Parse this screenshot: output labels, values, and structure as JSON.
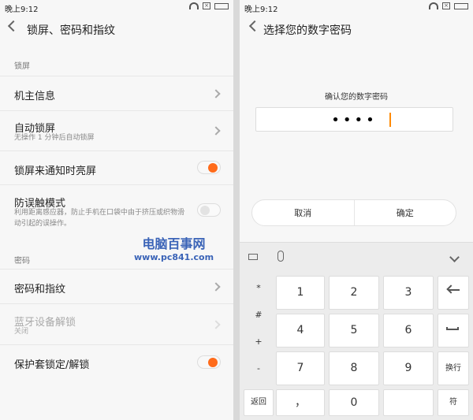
{
  "left": {
    "status": {
      "time": "晚上9:12",
      "close_badge": "×"
    },
    "header": {
      "title": "锁屏、密码和指纹"
    },
    "sections": [
      {
        "label": "锁屏"
      },
      {
        "label": "密码"
      }
    ],
    "items": [
      {
        "title": "机主信息"
      },
      {
        "title": "自动锁屏",
        "subtitle": "无操作 1 分钟后自动锁屏"
      },
      {
        "title": "锁屏来通知时亮屏",
        "toggle": "on"
      },
      {
        "title": "防误触模式",
        "subtitle": "利用距离感应器，防止手机在口袋中由于挤压或织物滑动引起的误操作。",
        "toggle": "off"
      },
      {
        "title": "密码和指纹"
      },
      {
        "title": "蓝牙设备解锁",
        "subtitle": "关闭",
        "disabled": true
      },
      {
        "title": "保护套锁定/解锁",
        "toggle": "on"
      }
    ],
    "watermark": {
      "line1": "电脑百事网",
      "line2": "www.pc841.com"
    }
  },
  "right": {
    "status": {
      "time": "晚上9:12",
      "close_badge": "×"
    },
    "header": {
      "title": "选择您的数字密码"
    },
    "prompt": "确认您的数字密码",
    "pin_dots": "••••",
    "buttons": {
      "cancel": "取消",
      "confirm": "确定"
    },
    "keyboard": {
      "left_symbols": [
        "*",
        "#",
        "+",
        "-"
      ],
      "return_label": "返回",
      "comma": "，",
      "keys": [
        "1",
        "2",
        "3",
        "4",
        "5",
        "6",
        "7",
        "8",
        "9",
        "0"
      ],
      "right_label_1": "换行",
      "right_label_2": "符"
    }
  },
  "colors": {
    "accent": "#ff6b1a",
    "background": "#f7f7f7",
    "watermark": "#3a63b7"
  }
}
